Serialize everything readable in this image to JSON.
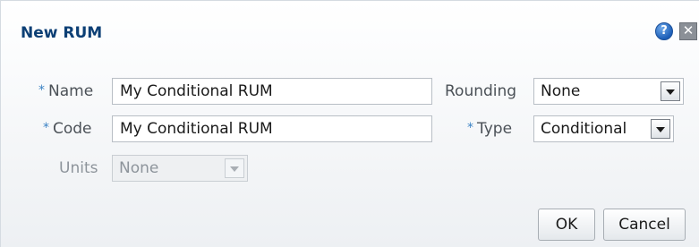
{
  "dialog": {
    "title": "New RUM",
    "help_glyph": "?",
    "close_glyph": "✕",
    "icons": {
      "help": "help-icon",
      "close": "close-icon",
      "dropdown": "chevron-down-icon"
    }
  },
  "form": {
    "required_marker": "*",
    "name": {
      "label": "Name",
      "value": "My Conditional RUM"
    },
    "code": {
      "label": "Code",
      "value": "My Conditional RUM"
    },
    "units": {
      "label": "Units",
      "value": "None",
      "disabled": true
    },
    "rounding": {
      "label": "Rounding",
      "value": "None"
    },
    "type": {
      "label": "Type",
      "value": "Conditional"
    }
  },
  "buttons": {
    "ok": "OK",
    "cancel": "Cancel"
  },
  "colors": {
    "title": "#0c3f75",
    "required": "#3b82c4",
    "label": "#4b5157"
  }
}
